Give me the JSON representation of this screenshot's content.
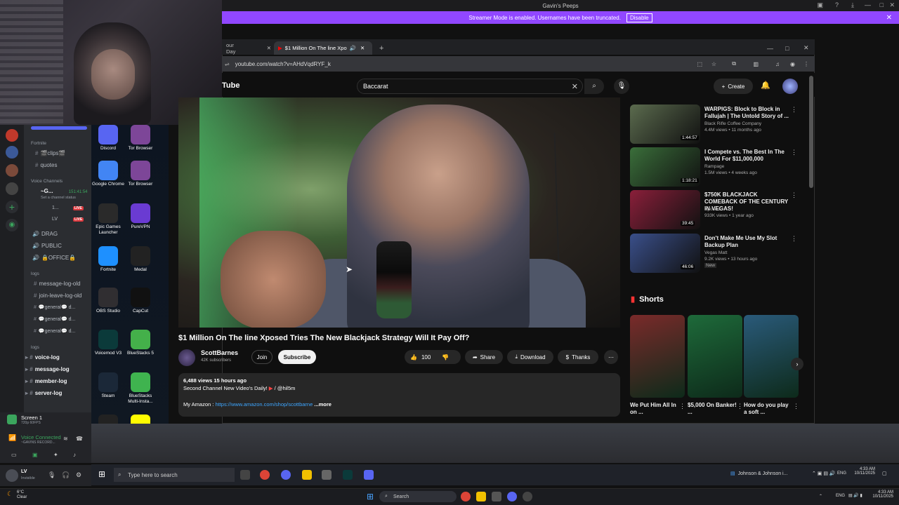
{
  "window": {
    "title": "Gavin's Peeps"
  },
  "streamer_banner": {
    "text": "Streamer Mode is enabled. Usernames have been truncated.",
    "button": "Disable"
  },
  "discord": {
    "categories": [
      "Fortnite",
      "Voice Channels",
      "logs",
      "logs"
    ],
    "channels_top": [
      "🎬clips🎬",
      "quotes"
    ],
    "voice_user": {
      "name": "~G...",
      "timer": "151:41:54",
      "status": "Set a channel status"
    },
    "voice_members": [
      {
        "name": "1...",
        "badge": "LIVE"
      },
      {
        "name": "LV",
        "badge": "LIVE"
      }
    ],
    "voice_channels": [
      "DRAG",
      "PUBLIC",
      "🔒OFFICE🔒"
    ],
    "log_channels": [
      "message-log-old",
      "join-leave-log-old",
      "💬general💬 d...",
      "💬general💬 d...",
      "💬general💬 d..."
    ],
    "log_folders": [
      "voice-log",
      "message-log",
      "member-log",
      "server-log"
    ],
    "screen": {
      "title": "Screen 1",
      "sub": "720p 60FPS"
    },
    "voice_connected": {
      "title": "Voice Connected",
      "sub": "~GAVINS RECORD..."
    },
    "user": {
      "name": "LV",
      "status": "Invisible"
    }
  },
  "desktop_icons": [
    {
      "label": "Discord",
      "color": "#5865f2"
    },
    {
      "label": "Tor Browser",
      "color": "#7d4698"
    },
    {
      "label": "Google Chrome",
      "color": "#4285f4"
    },
    {
      "label": "Tor Browser",
      "color": "#7d4698"
    },
    {
      "label": "Epic Games Launcher",
      "color": "#2a2a2a"
    },
    {
      "label": "PureVPN",
      "color": "#6a3bd2"
    },
    {
      "label": "Fortnite",
      "color": "#1e90ff"
    },
    {
      "label": "Medal",
      "color": "#222222"
    },
    {
      "label": "OBS Studio",
      "color": "#302e31"
    },
    {
      "label": "CapCut",
      "color": "#111111"
    },
    {
      "label": "Voicemod V3",
      "color": "#0b3a3a"
    },
    {
      "label": "BlueStacks 5",
      "color": "#44b04a"
    },
    {
      "label": "Steam",
      "color": "#1b2838"
    },
    {
      "label": "BlueStacks Multi-Insta...",
      "color": "#3fb34f"
    },
    {
      "label": "Vegas Infinite by PokerStars",
      "color": "#222"
    },
    {
      "label": "Snapchat",
      "color": "#fffc00"
    }
  ],
  "browser": {
    "tabs": [
      {
        "label": "our Day"
      },
      {
        "label": "$1 Million On The line Xpo"
      }
    ],
    "url": "youtube.com/watch?v=AHdVqdRYF_k"
  },
  "youtube": {
    "logo": "Tube",
    "search_value": "Baccarat",
    "create": "Create",
    "video_title": "$1 Million On The line Xposed Tries The New Blackjack Strategy Will It Pay Off?",
    "channel_name": "ScottBarnes",
    "subscribers": "42K subscribers",
    "join": "Join",
    "subscribe": "Subscribe",
    "likes": "100",
    "share": "Share",
    "download": "Download",
    "thanks": "Thanks",
    "views": "6,488 views",
    "age": "15 hours ago",
    "desc_line": "Second Channel New Video's Daily!",
    "desc_handle": "/ @hil5m",
    "amazon_label": "My Amazon :",
    "amazon_link": "https://www.amazon.com/shop/scottbarne",
    "more": "...more",
    "shorts_heading": "Shorts"
  },
  "recommendations": [
    {
      "title": "WARPIGS: Block to Block in Fallujah | The Untold Story of ...",
      "channel": "Black Rifle Coffee Company",
      "meta": "4.4M views • 11 months ago",
      "duration": "1:44:57",
      "color": "#5b6b4e"
    },
    {
      "title": "I Compete vs. The Best In The World For $11,000,000",
      "channel": "Rampage",
      "meta": "1.5M views • 4 weeks ago",
      "duration": "1:18:21",
      "color": "#3a6e3a"
    },
    {
      "title": "$750K BLACKJACK COMEBACK OF THE CENTURY IN VEGAS!",
      "channel": "Xposed",
      "meta": "933K views • 1 year ago",
      "duration": "39:45",
      "color": "#8a1f3a"
    },
    {
      "title": "Don't Make Me Use My Slot Backup Plan",
      "channel": "Vegas Matt",
      "meta": "9.2K views • 13 hours ago",
      "badge": "New",
      "duration": "46:06",
      "color": "#3a4f8a"
    }
  ],
  "shorts": [
    {
      "title": "We Put Him All In on ...",
      "color": "#7a2a2a"
    },
    {
      "title": "$5,000 On Banker! ...",
      "color": "#1e6a3a"
    },
    {
      "title": "How do you play a soft ...",
      "color": "#2a5a7a"
    }
  ],
  "taskbar": {
    "search_placeholder": "Type here to search",
    "news": "Johnson & Johnson i...",
    "time": "4:33 AM",
    "date": "10/11/2025",
    "lang": "ENG"
  },
  "taskbar2": {
    "weather_temp": "6°C",
    "weather_desc": "Clear",
    "search": "Search",
    "lang": "ENG",
    "time": "4:33 AM",
    "date": "10/11/2025"
  }
}
